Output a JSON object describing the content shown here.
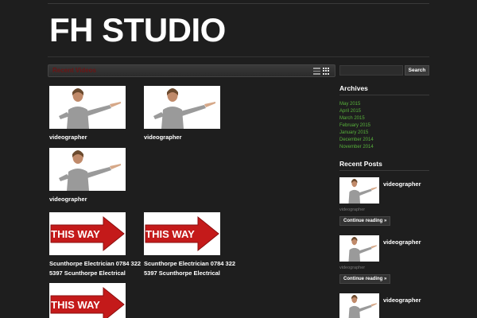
{
  "site": {
    "title": "FH STUDIO"
  },
  "main": {
    "section_title": "Recent Videos",
    "videos": [
      {
        "title_line1": "videographer",
        "title_line2": "",
        "thumb": "woman-pointing"
      },
      {
        "title_line1": "videographer",
        "title_line2": "",
        "thumb": "woman-pointing"
      },
      {
        "title_line1": "videographer",
        "title_line2": "",
        "thumb": "woman-pointing"
      },
      {
        "title_line1": "Scunthorpe Electrician 0784 322",
        "title_line2": "5397 Scunthorpe Electrical",
        "thumb": "this-way-arrow"
      },
      {
        "title_line1": "Scunthorpe Electrician 0784 322",
        "title_line2": "5397 Scunthorpe Electrical",
        "thumb": "this-way-arrow"
      },
      {
        "title_line1": "",
        "title_line2": "",
        "thumb": "this-way-arrow"
      }
    ],
    "arrow_text": "THIS WAY"
  },
  "sidebar": {
    "search": {
      "button_label": "Search",
      "placeholder": ""
    },
    "archives": {
      "title": "Archives",
      "items": [
        "May 2015",
        "April 2015",
        "March 2015",
        "February 2015",
        "January 2015",
        "December 2014",
        "November 2014"
      ]
    },
    "recent_posts": {
      "title": "Recent Posts",
      "posts": [
        {
          "title": "videographer",
          "category": "videographer",
          "button": "Continue reading »"
        },
        {
          "title": "videographer",
          "category": "videographer",
          "button": "Continue reading »"
        },
        {
          "title": "videographer",
          "category": "",
          "button": ""
        }
      ]
    }
  },
  "colors": {
    "background": "#1e1e1e",
    "link_green": "#58b23b",
    "section_title": "#6b1414",
    "arrow_red": "#c41a1a"
  }
}
